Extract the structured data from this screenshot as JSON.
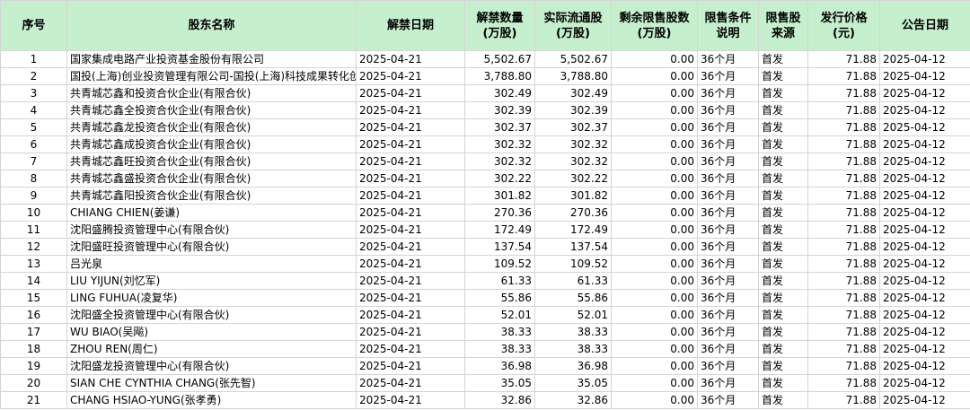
{
  "columns": [
    {
      "key": "idx",
      "label": "序号",
      "align": "c-idx"
    },
    {
      "key": "name",
      "label": "股东名称",
      "align": "c-txt"
    },
    {
      "key": "unlock_date",
      "label": "解禁日期",
      "align": "c-txt"
    },
    {
      "key": "unlock_qty",
      "label": "解禁数量\n(万股)",
      "align": "c-num"
    },
    {
      "key": "actual_float",
      "label": "实际流通股\n(万股)",
      "align": "c-num"
    },
    {
      "key": "remaining",
      "label": "剩余限售股数\n(万股)",
      "align": "c-num"
    },
    {
      "key": "condition",
      "label": "限售条件\n说明",
      "align": "c-txt"
    },
    {
      "key": "source",
      "label": "限售股\n来源",
      "align": "c-txt"
    },
    {
      "key": "price",
      "label": "发行价格\n(元)",
      "align": "c-num"
    },
    {
      "key": "announce_date",
      "label": "公告日期",
      "align": "c-txt"
    }
  ],
  "rows": [
    [
      "1",
      "国家集成电路产业投资基金股份有限公司",
      "2025-04-21",
      "5,502.67",
      "5,502.67",
      "0.00",
      "36个月",
      "首发",
      "71.88",
      "2025-04-12"
    ],
    [
      "2",
      "国投(上海)创业投资管理有限公司-国投(上海)科技成果转化创业投资基金企业(有限合伙)",
      "2025-04-21",
      "3,788.80",
      "3,788.80",
      "0.00",
      "36个月",
      "首发",
      "71.88",
      "2025-04-12"
    ],
    [
      "3",
      "共青城芯鑫和投资合伙企业(有限合伙)",
      "2025-04-21",
      "302.49",
      "302.49",
      "0.00",
      "36个月",
      "首发",
      "71.88",
      "2025-04-12"
    ],
    [
      "4",
      "共青城芯鑫全投资合伙企业(有限合伙)",
      "2025-04-21",
      "302.39",
      "302.39",
      "0.00",
      "36个月",
      "首发",
      "71.88",
      "2025-04-12"
    ],
    [
      "5",
      "共青城芯鑫龙投资合伙企业(有限合伙)",
      "2025-04-21",
      "302.37",
      "302.37",
      "0.00",
      "36个月",
      "首发",
      "71.88",
      "2025-04-12"
    ],
    [
      "6",
      "共青城芯鑫成投资合伙企业(有限合伙)",
      "2025-04-21",
      "302.32",
      "302.32",
      "0.00",
      "36个月",
      "首发",
      "71.88",
      "2025-04-12"
    ],
    [
      "7",
      "共青城芯鑫旺投资合伙企业(有限合伙)",
      "2025-04-21",
      "302.32",
      "302.32",
      "0.00",
      "36个月",
      "首发",
      "71.88",
      "2025-04-12"
    ],
    [
      "8",
      "共青城芯鑫盛投资合伙企业(有限合伙)",
      "2025-04-21",
      "302.22",
      "302.22",
      "0.00",
      "36个月",
      "首发",
      "71.88",
      "2025-04-12"
    ],
    [
      "9",
      "共青城芯鑫阳投资合伙企业(有限合伙)",
      "2025-04-21",
      "301.82",
      "301.82",
      "0.00",
      "36个月",
      "首发",
      "71.88",
      "2025-04-12"
    ],
    [
      "10",
      "CHIANG CHIEN(姜谦)",
      "2025-04-21",
      "270.36",
      "270.36",
      "0.00",
      "36个月",
      "首发",
      "71.88",
      "2025-04-12"
    ],
    [
      "11",
      "沈阳盛腾投资管理中心(有限合伙)",
      "2025-04-21",
      "172.49",
      "172.49",
      "0.00",
      "36个月",
      "首发",
      "71.88",
      "2025-04-12"
    ],
    [
      "12",
      "沈阳盛旺投资管理中心(有限合伙)",
      "2025-04-21",
      "137.54",
      "137.54",
      "0.00",
      "36个月",
      "首发",
      "71.88",
      "2025-04-12"
    ],
    [
      "13",
      "吕光泉",
      "2025-04-21",
      "109.52",
      "109.52",
      "0.00",
      "36个月",
      "首发",
      "71.88",
      "2025-04-12"
    ],
    [
      "14",
      "LIU YIJUN(刘忆军)",
      "2025-04-21",
      "61.33",
      "61.33",
      "0.00",
      "36个月",
      "首发",
      "71.88",
      "2025-04-12"
    ],
    [
      "15",
      "LING FUHUA(凌复华)",
      "2025-04-21",
      "55.86",
      "55.86",
      "0.00",
      "36个月",
      "首发",
      "71.88",
      "2025-04-12"
    ],
    [
      "16",
      "沈阳盛全投资管理中心(有限合伙)",
      "2025-04-21",
      "52.01",
      "52.01",
      "0.00",
      "36个月",
      "首发",
      "71.88",
      "2025-04-12"
    ],
    [
      "17",
      "WU BIAO(吴飚)",
      "2025-04-21",
      "38.33",
      "38.33",
      "0.00",
      "36个月",
      "首发",
      "71.88",
      "2025-04-12"
    ],
    [
      "18",
      "ZHOU REN(周仁)",
      "2025-04-21",
      "38.33",
      "38.33",
      "0.00",
      "36个月",
      "首发",
      "71.88",
      "2025-04-12"
    ],
    [
      "19",
      "沈阳盛龙投资管理中心(有限合伙)",
      "2025-04-21",
      "36.98",
      "36.98",
      "0.00",
      "36个月",
      "首发",
      "71.88",
      "2025-04-12"
    ],
    [
      "20",
      "SIAN CHE CYNTHIA CHANG(张先智)",
      "2025-04-21",
      "35.05",
      "35.05",
      "0.00",
      "36个月",
      "首发",
      "71.88",
      "2025-04-12"
    ],
    [
      "21",
      "CHANG HSIAO-YUNG(张孝勇)",
      "2025-04-21",
      "32.86",
      "32.86",
      "0.00",
      "36个月",
      "首发",
      "71.88",
      "2025-04-12"
    ]
  ],
  "colors": {
    "header_bg": "#c6efce",
    "grid_line": "#d4d4d4"
  }
}
